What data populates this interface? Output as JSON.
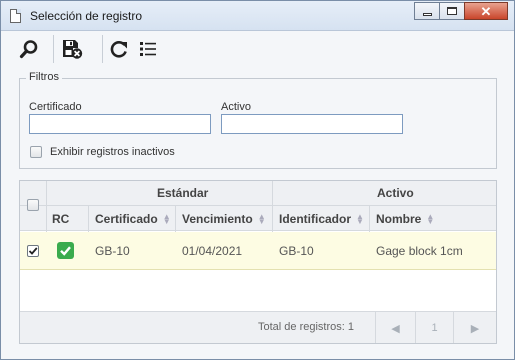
{
  "window": {
    "title": "Selección de registro",
    "controls": {
      "minimize_icon": "minimize-icon",
      "maximize_icon": "maximize-icon",
      "close_icon": "close-icon"
    }
  },
  "toolbar": {
    "buttons": [
      {
        "icon": "search-icon"
      },
      {
        "icon": "save-cancel-icon"
      },
      {
        "icon": "refresh-icon"
      },
      {
        "icon": "list-icon"
      }
    ]
  },
  "filters": {
    "legend": "Filtros",
    "certificado_label": "Certificado",
    "certificado_value": "",
    "activo_label": "Activo",
    "activo_value": "",
    "inactive_label": "Exhibir registros inactivos",
    "inactive_checked": false
  },
  "grid": {
    "groups": {
      "estandar": "Estándar",
      "activo": "Activo"
    },
    "columns": [
      "RC",
      "Certificado",
      "Vencimiento",
      "Identificador",
      "Nombre"
    ],
    "rows": [
      {
        "selected": true,
        "rc": true,
        "certificado": "GB-10",
        "vencimiento": "01/04/2021",
        "identificador": "GB-10",
        "nombre": "Gage block 1cm"
      }
    ],
    "footer": {
      "total": "Total de registros: 1",
      "page": "1"
    }
  },
  "colors": {
    "check_green": "#3aab4e",
    "selected_row": "#fdfce3",
    "close_red": "#c9452b"
  }
}
